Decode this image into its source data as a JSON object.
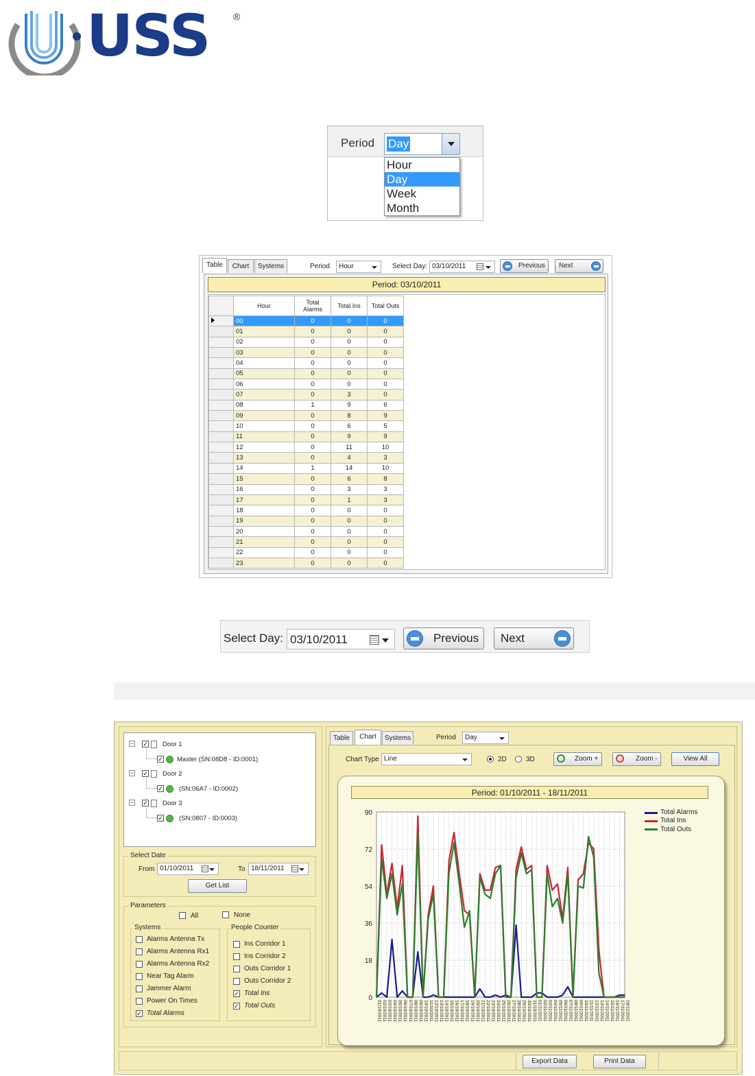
{
  "logo": {
    "text": "USS",
    "reg_mark": "®"
  },
  "period_dropdown": {
    "label": "Period",
    "selected": "Day",
    "options": [
      "Hour",
      "Day",
      "Week",
      "Month"
    ]
  },
  "table_view": {
    "tabs": [
      "Table",
      "Chart",
      "Systems"
    ],
    "period_label": "Period",
    "period_value": "Hour",
    "select_day_label": "Select Day:",
    "select_day_value": "03/10/2011",
    "previous_label": "Previous",
    "next_label": "Next",
    "period_banner": "Period: 03/10/2011",
    "columns": [
      "Hour",
      "Total Alarms",
      "Total Ins",
      "Total Outs"
    ],
    "rows": [
      [
        "00",
        "0",
        "0",
        "0"
      ],
      [
        "01",
        "0",
        "0",
        "0"
      ],
      [
        "02",
        "0",
        "0",
        "0"
      ],
      [
        "03",
        "0",
        "0",
        "0"
      ],
      [
        "04",
        "0",
        "0",
        "0"
      ],
      [
        "05",
        "0",
        "0",
        "0"
      ],
      [
        "06",
        "0",
        "0",
        "0"
      ],
      [
        "07",
        "0",
        "3",
        "0"
      ],
      [
        "08",
        "1",
        "9",
        "6"
      ],
      [
        "09",
        "0",
        "8",
        "9"
      ],
      [
        "10",
        "0",
        "6",
        "5"
      ],
      [
        "11",
        "0",
        "9",
        "9"
      ],
      [
        "12",
        "0",
        "11",
        "10"
      ],
      [
        "13",
        "0",
        "4",
        "3"
      ],
      [
        "14",
        "1",
        "14",
        "10"
      ],
      [
        "15",
        "0",
        "6",
        "8"
      ],
      [
        "16",
        "0",
        "3",
        "3"
      ],
      [
        "17",
        "0",
        "1",
        "3"
      ],
      [
        "18",
        "0",
        "0",
        "0"
      ],
      [
        "19",
        "0",
        "0",
        "0"
      ],
      [
        "20",
        "0",
        "0",
        "0"
      ],
      [
        "21",
        "0",
        "0",
        "0"
      ],
      [
        "22",
        "0",
        "0",
        "0"
      ],
      [
        "23",
        "0",
        "0",
        "0"
      ]
    ]
  },
  "select_day_bar": {
    "label": "Select Day:",
    "value": "03/10/2011",
    "previous_label": "Previous",
    "next_label": "Next"
  },
  "chart_view": {
    "tree": [
      {
        "label": "Door 1",
        "child": "Master (SN:08D8 - ID:0001)"
      },
      {
        "label": "Door 2",
        "child": "(SN:06A7 - ID:0002)"
      },
      {
        "label": "Door 3",
        "child": "(SN:0807 - ID:0003)"
      }
    ],
    "select_date_label": "Select Date",
    "from_label": "From",
    "from_value": "01/10/2011",
    "to_label": "To",
    "to_value": "18/11/2011",
    "get_list_label": "Get List",
    "parameters_label": "Parameters",
    "all_label": "All",
    "none_label": "None",
    "systems_label": "Systems",
    "systems": [
      {
        "label": "Alarms Antenna Tx",
        "checked": false
      },
      {
        "label": "Alarms Antenna Rx1",
        "checked": false
      },
      {
        "label": "Alarms Antenna Rx2",
        "checked": false
      },
      {
        "label": "Near Tag Alarm",
        "checked": false
      },
      {
        "label": "Jammer Alarm",
        "checked": false
      },
      {
        "label": "Power On Times",
        "checked": false
      },
      {
        "label": "Total Alarms",
        "checked": true
      }
    ],
    "people_counter_label": "People Counter",
    "people_counter": [
      {
        "label": "Ins Corridor 1",
        "checked": false
      },
      {
        "label": "Ins Corridor 2",
        "checked": false
      },
      {
        "label": "Outs Corridor 1",
        "checked": false
      },
      {
        "label": "Outs Corridor 2",
        "checked": false
      },
      {
        "label": "Total Ins",
        "checked": true
      },
      {
        "label": "Total Outs",
        "checked": true
      }
    ],
    "tabs": [
      "Table",
      "Chart",
      "Systems"
    ],
    "period_label": "Period",
    "period_value": "Day",
    "chart_type_label": "Chart Type",
    "chart_type_value": "Line",
    "mode_2d": "2D",
    "mode_3d": "3D",
    "zoom_in_label": "Zoom +",
    "zoom_out_label": "Zoom -",
    "view_all_label": "View All",
    "export_label": "Export Data",
    "print_label": "Print Data"
  },
  "chart_data": {
    "type": "line",
    "title": "Period: 01/10/2011 - 18/11/2011",
    "ylim": [
      0,
      90
    ],
    "yticks": [
      0,
      18,
      36,
      54,
      72,
      90
    ],
    "x": [
      "01/10",
      "02/10",
      "03/10",
      "04/10",
      "05/10",
      "06/10",
      "07/10",
      "08/10",
      "09/10",
      "10/10",
      "11/10",
      "12/10",
      "13/10",
      "14/10",
      "15/10",
      "16/10",
      "17/10",
      "18/10",
      "19/10",
      "20/10",
      "21/10",
      "22/10",
      "23/10",
      "24/10",
      "25/10",
      "26/10",
      "27/10",
      "28/10",
      "29/10",
      "30/10",
      "31/10",
      "01/11",
      "02/11",
      "03/11",
      "04/11",
      "05/11",
      "06/11",
      "07/11",
      "08/11",
      "09/11",
      "10/11",
      "11/11",
      "12/11",
      "13/11",
      "14/11",
      "15/11",
      "16/11",
      "17/11",
      "18/11"
    ],
    "series": [
      {
        "name": "Total Alarms",
        "color": "#1a1a8c",
        "values": [
          0,
          2,
          0,
          28,
          0,
          3,
          0,
          0,
          22,
          0,
          0,
          1,
          0,
          0,
          0,
          0,
          0,
          0,
          0,
          0,
          4,
          0,
          0,
          1,
          0,
          1,
          0,
          35,
          0,
          0,
          0,
          2,
          2,
          0,
          0,
          0,
          1,
          5,
          0,
          0,
          0,
          0,
          0,
          0,
          0,
          0,
          0,
          1,
          1
        ]
      },
      {
        "name": "Total Ins",
        "color": "#cc2233",
        "values": [
          0,
          74,
          50,
          65,
          43,
          64,
          0,
          0,
          88,
          0,
          40,
          54,
          0,
          0,
          66,
          80,
          60,
          42,
          40,
          0,
          60,
          52,
          52,
          63,
          64,
          0,
          0,
          62,
          73,
          62,
          64,
          0,
          0,
          64,
          52,
          55,
          38,
          63,
          0,
          57,
          60,
          75,
          72,
          23,
          0,
          0,
          0,
          0,
          0
        ]
      },
      {
        "name": "Total Outs",
        "color": "#2e7d2e",
        "values": [
          0,
          67,
          48,
          60,
          40,
          55,
          0,
          0,
          80,
          0,
          38,
          50,
          0,
          0,
          60,
          75,
          55,
          34,
          42,
          0,
          58,
          50,
          48,
          60,
          64,
          0,
          0,
          58,
          70,
          60,
          62,
          0,
          0,
          60,
          44,
          48,
          36,
          60,
          0,
          54,
          53,
          78,
          68,
          12,
          0,
          0,
          0,
          0,
          0
        ]
      }
    ],
    "legend": [
      "Total Alarms",
      "Total Ins",
      "Total Outs"
    ],
    "legend_position": "right",
    "grid": true
  }
}
